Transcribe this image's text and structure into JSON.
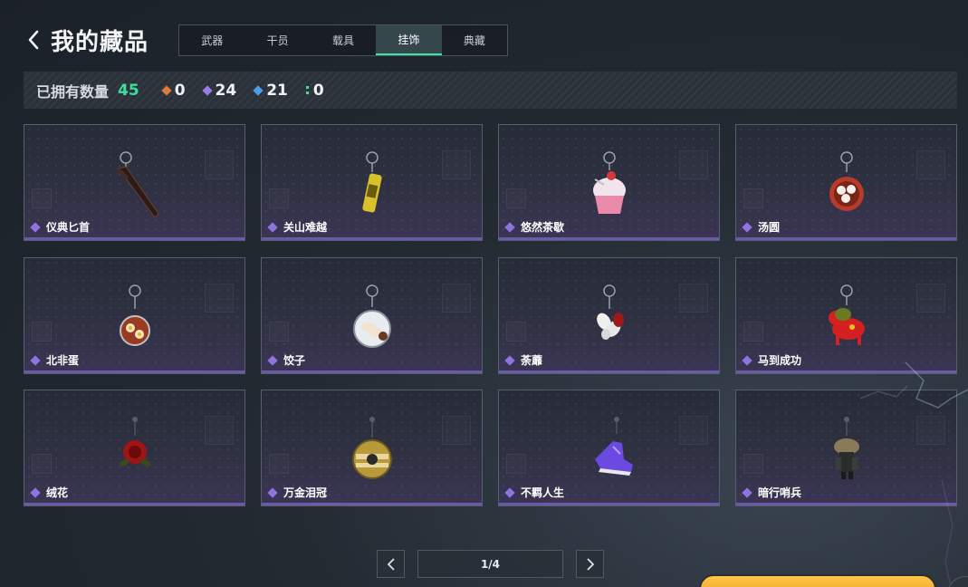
{
  "header": {
    "title": "我的藏品"
  },
  "tabs": [
    {
      "label": "武器"
    },
    {
      "label": "干员"
    },
    {
      "label": "载具"
    },
    {
      "label": "挂饰",
      "active": true
    },
    {
      "label": "典藏"
    }
  ],
  "stats": {
    "label": "已拥有数量",
    "total": "45",
    "rarities": [
      {
        "color": "#e07a3a",
        "count": "0"
      },
      {
        "color": "#9a7ae8",
        "count": "24"
      },
      {
        "color": "#4a9ee8",
        "count": "21"
      },
      {
        "color": "#3ddf9a",
        "count": "0"
      }
    ]
  },
  "items": [
    {
      "name": "仪典匕首",
      "icon": "dagger-charm-icon"
    },
    {
      "name": "关山难越",
      "icon": "yellow-can-charm-icon"
    },
    {
      "name": "悠然茶歇",
      "icon": "cupcake-charm-icon"
    },
    {
      "name": "汤圆",
      "icon": "tangyuan-bowl-charm-icon"
    },
    {
      "name": "北非蛋",
      "icon": "shakshuka-pan-charm-icon"
    },
    {
      "name": "饺子",
      "icon": "dumpling-plate-charm-icon"
    },
    {
      "name": "荼蘼",
      "icon": "flower-charm-icon"
    },
    {
      "name": "马到成功",
      "icon": "red-horse-charm-icon"
    },
    {
      "name": "绒花",
      "icon": "red-rose-charm-icon"
    },
    {
      "name": "万金泪冠",
      "icon": "gold-crown-charm-icon"
    },
    {
      "name": "不羁人生",
      "icon": "purple-sneaker-charm-icon"
    },
    {
      "name": "暗行哨兵",
      "icon": "sentinel-figure-charm-icon"
    }
  ],
  "pagination": {
    "label": "1/4"
  },
  "colors": {
    "accent": "#3ddf9a",
    "rarity_purple": "#8f74e0"
  }
}
